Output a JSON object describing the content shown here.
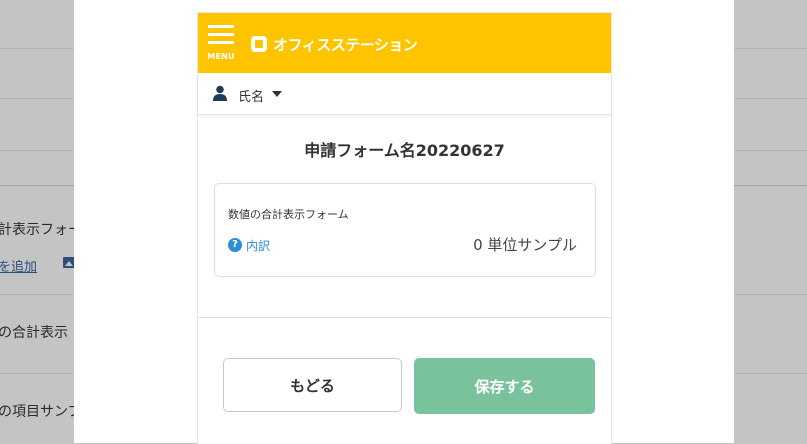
{
  "background": {
    "fragments": [
      "計表示フォー",
      "の合計表示",
      "の項目サンプ"
    ],
    "link": "を追加"
  },
  "app": {
    "menu_label": "MENU",
    "brand": "オフィスステーション",
    "brand_color": "#ffc400"
  },
  "user": {
    "name": "氏名",
    "icon": "person-icon"
  },
  "form": {
    "title": "申請フォーム名20220627",
    "field": {
      "label": "数値の合計表示フォーム",
      "help_link": "内訳",
      "help_icon": "question-circle-icon",
      "value": "0 単位サンプル"
    }
  },
  "actions": {
    "back_label": "もどる",
    "save_label": "保存する",
    "save_color": "#79c29c"
  }
}
